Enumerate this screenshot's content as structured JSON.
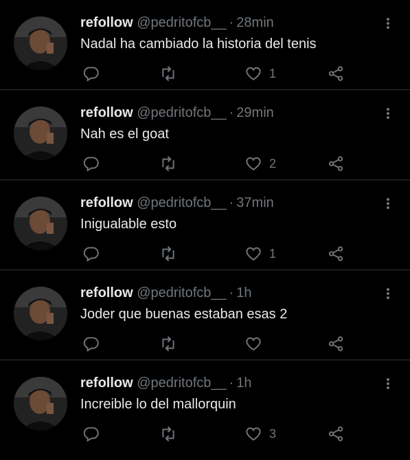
{
  "tweets": [
    {
      "name": "refollow",
      "handle": "@pedritofcb__",
      "time": "28min",
      "text": "Nadal ha cambiado la historia del tenis",
      "likes": "1"
    },
    {
      "name": "refollow",
      "handle": "@pedritofcb__",
      "time": "29min",
      "text": "Nah es el goat",
      "likes": "2"
    },
    {
      "name": "refollow",
      "handle": "@pedritofcb__",
      "time": "37min",
      "text": "Inigualable esto",
      "likes": "1"
    },
    {
      "name": "refollow",
      "handle": "@pedritofcb__",
      "time": "1h",
      "text": "Joder que buenas estaban esas 2",
      "likes": ""
    },
    {
      "name": "refollow",
      "handle": "@pedritofcb__",
      "time": "1h",
      "text": "Increible lo del mallorquin",
      "likes": "3"
    }
  ],
  "separator": "·",
  "colors": {
    "background": "#000000",
    "text": "#e7e9ea",
    "muted": "#71767b",
    "divider": "#2f3336"
  },
  "icons": {
    "reply": "reply-icon",
    "retweet": "retweet-icon",
    "like": "heart-icon",
    "share": "share-icon",
    "more": "more-icon"
  }
}
